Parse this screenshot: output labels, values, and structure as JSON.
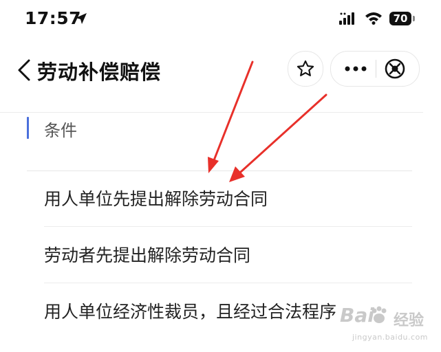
{
  "status_bar": {
    "time": "17:57",
    "battery": "70"
  },
  "nav": {
    "title": "劳动补偿赔偿"
  },
  "section": {
    "title": "条件"
  },
  "options": [
    {
      "label": "用人单位先提出解除劳动合同"
    },
    {
      "label": "劳动者先提出解除劳动合同"
    },
    {
      "label": "用人单位经济性裁员，且经过合法程序"
    }
  ],
  "colors": {
    "accent_bar": "#4a6fdc",
    "annotation_arrow": "#e8302a"
  },
  "watermark": {
    "brand": "Bai",
    "brand_suffix": "经验",
    "url": "jingyan.baidu.com"
  }
}
